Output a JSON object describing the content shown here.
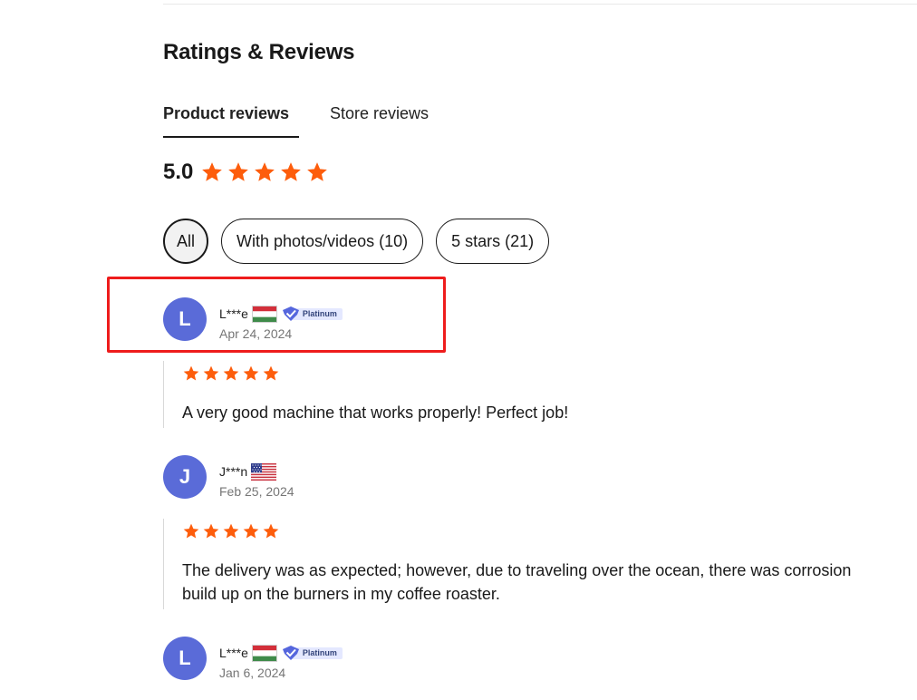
{
  "section": {
    "title": "Ratings & Reviews",
    "tabs": [
      {
        "label": "Product reviews",
        "active": true
      },
      {
        "label": "Store reviews",
        "active": false
      }
    ],
    "overall_rating": "5.0",
    "overall_stars": 5,
    "filters": [
      {
        "label": "All",
        "active": true
      },
      {
        "label": "With photos/videos (10)",
        "active": false
      },
      {
        "label": "5 stars (21)",
        "active": false
      }
    ]
  },
  "colors": {
    "star": "#fd5d0c",
    "avatar": "#5a6bd8",
    "highlight_box": "#ee1c1c",
    "badge_bg": "#e4e8ff",
    "badge_icon": "#5566dd"
  },
  "reviews": [
    {
      "avatar_initial": "L",
      "username": "L***e",
      "flag": "hungary-flag-icon",
      "badge": "Platinum",
      "date": "Apr 24, 2024",
      "stars": 5,
      "text_lines": [
        "A very good machine that works properly! Perfect job!"
      ]
    },
    {
      "avatar_initial": "J",
      "username": "J***n",
      "flag": "usa-flag-icon",
      "date": "Feb 25, 2024",
      "stars": 5,
      "text_lines": [
        "The delivery was as expected; however, due to traveling over the ocean, there was corrosion",
        "build up on the burners in my coffee roaster."
      ]
    },
    {
      "avatar_initial": "L",
      "username": "L***e",
      "flag": "hungary-flag-icon",
      "badge": "Platinum",
      "date": "Jan 6, 2024"
    }
  ]
}
